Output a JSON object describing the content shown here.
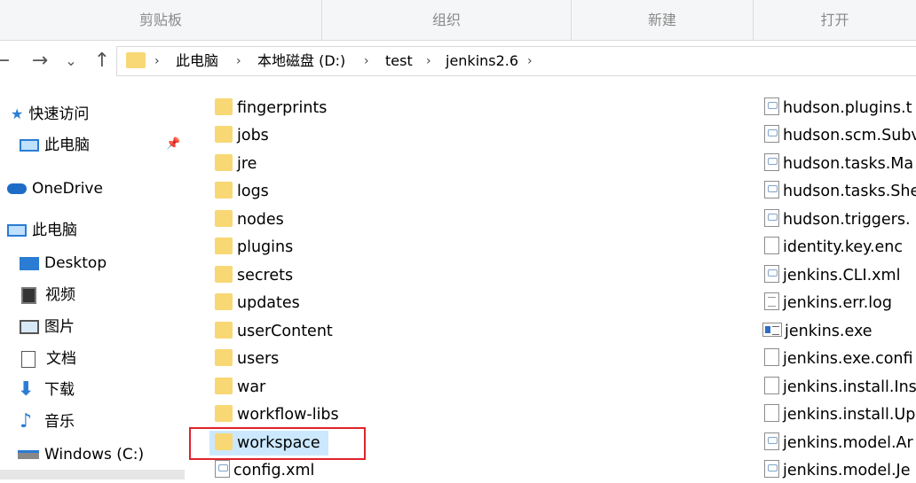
{
  "ribbon": {
    "groups": [
      "剪贴板",
      "组织",
      "新建",
      "打开"
    ]
  },
  "nav_buttons": {
    "back": "←",
    "forward": "→",
    "recent": "⌄",
    "up": "↑"
  },
  "breadcrumb": [
    "此电脑",
    "本地磁盘 (D:)",
    "test",
    "jenkins2.6"
  ],
  "sidebar": {
    "items": [
      {
        "label": "快速访问",
        "icon": "star-icon"
      },
      {
        "label": "此电脑",
        "icon": "computer-icon"
      },
      {
        "label": "OneDrive",
        "icon": "cloud-icon"
      },
      {
        "label": "此电脑",
        "icon": "computer-icon"
      },
      {
        "label": "Desktop",
        "icon": "desktop-icon"
      },
      {
        "label": "视频",
        "icon": "video-icon"
      },
      {
        "label": "图片",
        "icon": "picture-icon"
      },
      {
        "label": "文档",
        "icon": "document-icon"
      },
      {
        "label": "下载",
        "icon": "download-icon"
      },
      {
        "label": "音乐",
        "icon": "music-icon"
      },
      {
        "label": "Windows (C:)",
        "icon": "drive-icon"
      }
    ]
  },
  "folders": [
    "fingerprints",
    "jobs",
    "jre",
    "logs",
    "nodes",
    "plugins",
    "secrets",
    "updates",
    "userContent",
    "users",
    "war",
    "workflow-libs",
    "workspace"
  ],
  "files_col1": [
    "config.xml"
  ],
  "files_col2": [
    {
      "name": "hudson.plugins.t",
      "type": "xml"
    },
    {
      "name": "hudson.scm.Subv",
      "type": "xml"
    },
    {
      "name": "hudson.tasks.Ma",
      "type": "xml"
    },
    {
      "name": "hudson.tasks.She",
      "type": "xml"
    },
    {
      "name": "hudson.triggers.",
      "type": "xml"
    },
    {
      "name": "identity.key.enc",
      "type": "blank"
    },
    {
      "name": "jenkins.CLI.xml",
      "type": "xml"
    },
    {
      "name": "jenkins.err.log",
      "type": "lines"
    },
    {
      "name": "jenkins.exe",
      "type": "exe"
    },
    {
      "name": "jenkins.exe.confi",
      "type": "blank"
    },
    {
      "name": "jenkins.install.Ins",
      "type": "blank"
    },
    {
      "name": "jenkins.install.Up",
      "type": "blank"
    },
    {
      "name": "jenkins.model.Ar",
      "type": "xml"
    },
    {
      "name": "jenkins.model.Je",
      "type": "xml"
    }
  ],
  "colors": {
    "folder": "#f8d775",
    "selection": "#cce8ff",
    "highlight": "#e0242a"
  }
}
